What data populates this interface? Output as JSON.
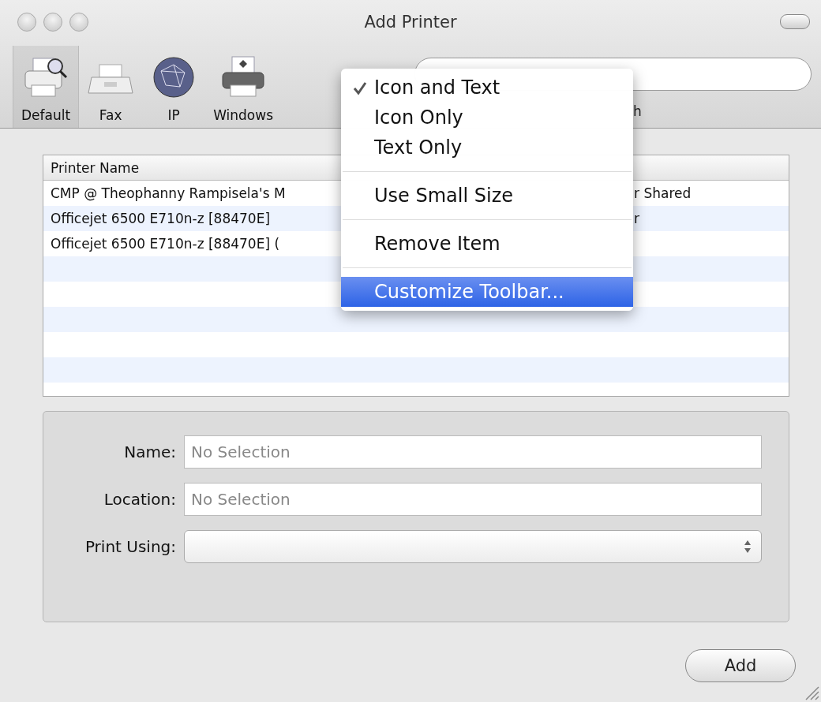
{
  "window": {
    "title": "Add Printer"
  },
  "toolbar": {
    "items": [
      {
        "label": "Default",
        "kind": "default",
        "selected": true
      },
      {
        "label": "Fax",
        "kind": "fax",
        "selected": false
      },
      {
        "label": "IP",
        "kind": "ip",
        "selected": false
      },
      {
        "label": "Windows",
        "kind": "windows",
        "selected": false
      }
    ],
    "search_label": "h"
  },
  "table": {
    "columns": [
      "Printer Name"
    ],
    "rows": [
      {
        "name": "CMP @ Theophanny Rampisela's M",
        "kind": "r Shared"
      },
      {
        "name": "Officejet 6500 E710n-z [88470E]",
        "kind": "r"
      },
      {
        "name": "Officejet 6500 E710n-z [88470E] (",
        "kind": ""
      }
    ]
  },
  "form": {
    "fields": [
      {
        "label": "Name:",
        "kind": "text",
        "placeholder": "No Selection"
      },
      {
        "label": "Location:",
        "kind": "text",
        "placeholder": "No Selection"
      },
      {
        "label": "Print Using:",
        "kind": "popup"
      }
    ]
  },
  "add_button": "Add",
  "context_menu": [
    {
      "kind": "item",
      "label": "Icon and Text",
      "checked": true,
      "selected": false
    },
    {
      "kind": "item",
      "label": "Icon Only",
      "checked": false,
      "selected": false
    },
    {
      "kind": "item",
      "label": "Text Only",
      "checked": false,
      "selected": false
    },
    {
      "kind": "separator"
    },
    {
      "kind": "item",
      "label": "Use Small Size",
      "checked": false,
      "selected": false
    },
    {
      "kind": "separator"
    },
    {
      "kind": "item",
      "label": "Remove Item",
      "checked": false,
      "selected": false
    },
    {
      "kind": "separator"
    },
    {
      "kind": "item",
      "label": "Customize Toolbar...",
      "checked": false,
      "selected": true
    }
  ]
}
